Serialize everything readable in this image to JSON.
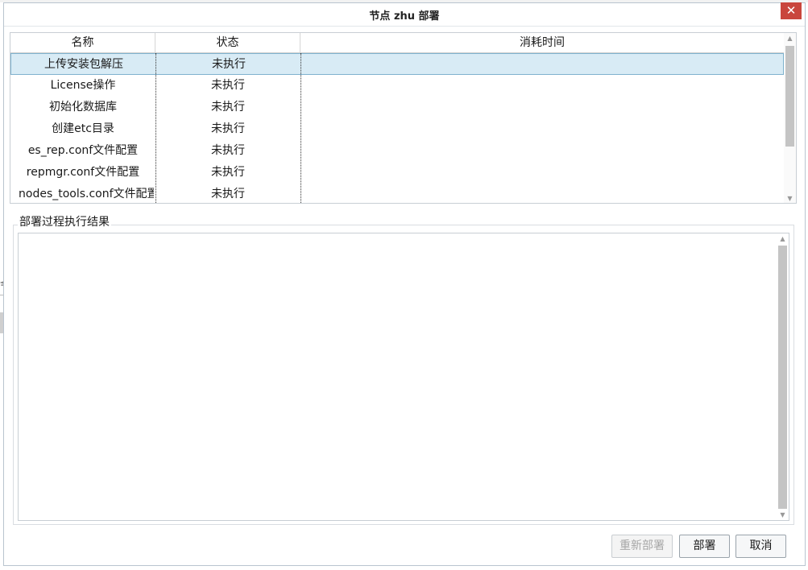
{
  "window": {
    "title": "节点 zhu 部署",
    "close_label": "✕"
  },
  "table": {
    "columns": [
      "名称",
      "状态",
      "消耗时间"
    ],
    "rows": [
      {
        "name": "上传安装包解压",
        "status": "未执行",
        "time": "",
        "selected": true
      },
      {
        "name": "License操作",
        "status": "未执行",
        "time": ""
      },
      {
        "name": "初始化数据库",
        "status": "未执行",
        "time": ""
      },
      {
        "name": "创建etc目录",
        "status": "未执行",
        "time": ""
      },
      {
        "name": "es_rep.conf文件配置",
        "status": "未执行",
        "time": ""
      },
      {
        "name": "repmgr.conf文件配置",
        "status": "未执行",
        "time": ""
      },
      {
        "name": "nodes_tools.conf文件配置",
        "status": "未执行",
        "time": ""
      }
    ]
  },
  "result": {
    "label": "部署过程执行结果",
    "content": ""
  },
  "buttons": {
    "redeploy": "重新部署",
    "deploy": "部署",
    "cancel": "取消"
  },
  "scroll": {
    "up_icon": "▲",
    "down_icon": "▼"
  },
  "background_fragment": "节",
  "colors": {
    "selected_row": "#d8ebf5",
    "close_button": "#c9463d"
  }
}
